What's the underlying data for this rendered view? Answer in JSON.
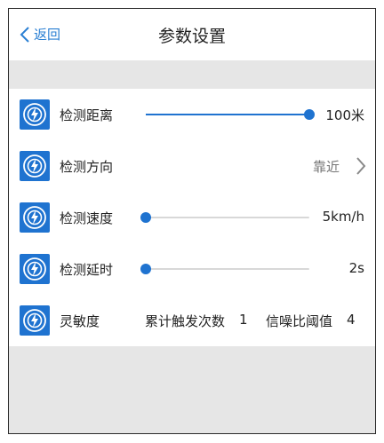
{
  "header": {
    "back_label": "返回",
    "title": "参数设置"
  },
  "rows": [
    {
      "label": "检测距离",
      "type": "slider",
      "value_text": "100米",
      "level": 1.0
    },
    {
      "label": "检测方向",
      "type": "select",
      "value_text": "靠近"
    },
    {
      "label": "检测速度",
      "type": "slider",
      "value_text": "5km/h",
      "level": 0.0
    },
    {
      "label": "检测延时",
      "type": "slider",
      "value_text": "2s",
      "level": 0.0
    },
    {
      "label": "灵敏度",
      "type": "sensitivity",
      "trigger_label": "累计触发次数",
      "trigger_value": "1",
      "snr_label": "信噪比阈值",
      "snr_value": "4"
    }
  ],
  "colors": {
    "accent": "#1f73d0",
    "band": "#e6e6e6",
    "back_link": "#2a7fd3"
  },
  "icons": {
    "row_icon": "radar-bolt-icon",
    "back": "chevron-left-icon",
    "more": "chevron-right-icon"
  }
}
